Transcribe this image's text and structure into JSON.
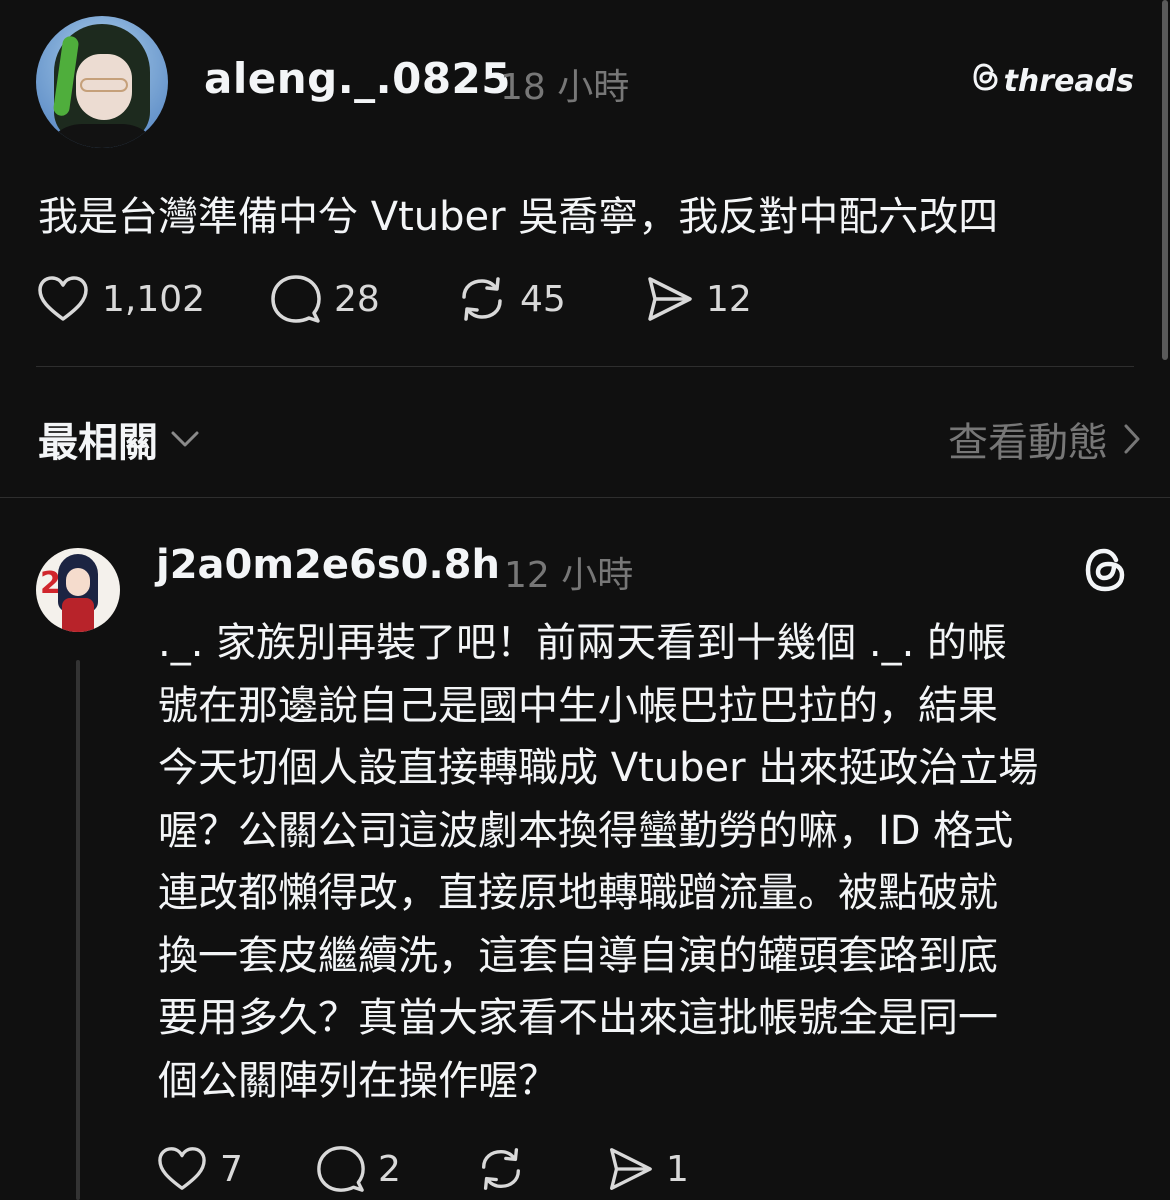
{
  "post": {
    "username": "aleng._.0825",
    "time": "18 小時",
    "brand": "threads",
    "text": "我是台灣準備中兮 Vtuber 吳喬寧，我反對中配六改四",
    "actions": {
      "likes": "1,102",
      "replies": "28",
      "reposts": "45",
      "shares": "12"
    }
  },
  "sort_bar": {
    "label": "最相關",
    "activity_link": "查看動態"
  },
  "reply": {
    "username": "j2a0m2e6s0.8h",
    "time": "12 小時",
    "lines": [
      "._. 家族別再裝了吧！前兩天看到十幾個 ._. 的帳",
      "號在那邊說自己是國中生小帳巴拉巴拉的，結果",
      "今天切個人設直接轉職成 Vtuber 出來挺政治立場",
      "喔？公關公司這波劇本換得蠻勤勞的嘛，ID 格式",
      "連改都懶得改，直接原地轉職蹭流量。被點破就",
      "換一套皮繼續洗，這套自導自演的罐頭套路到底",
      "要用多久？真當大家看不出來這批帳號全是同一",
      "個公關陣列在操作喔？"
    ],
    "actions": {
      "likes": "7",
      "replies": "2",
      "shares": "1"
    }
  },
  "colors": {
    "background": "#101010",
    "text_primary": "#f3f5f7",
    "text_secondary": "#777777",
    "divider": "#2e2e2e"
  }
}
